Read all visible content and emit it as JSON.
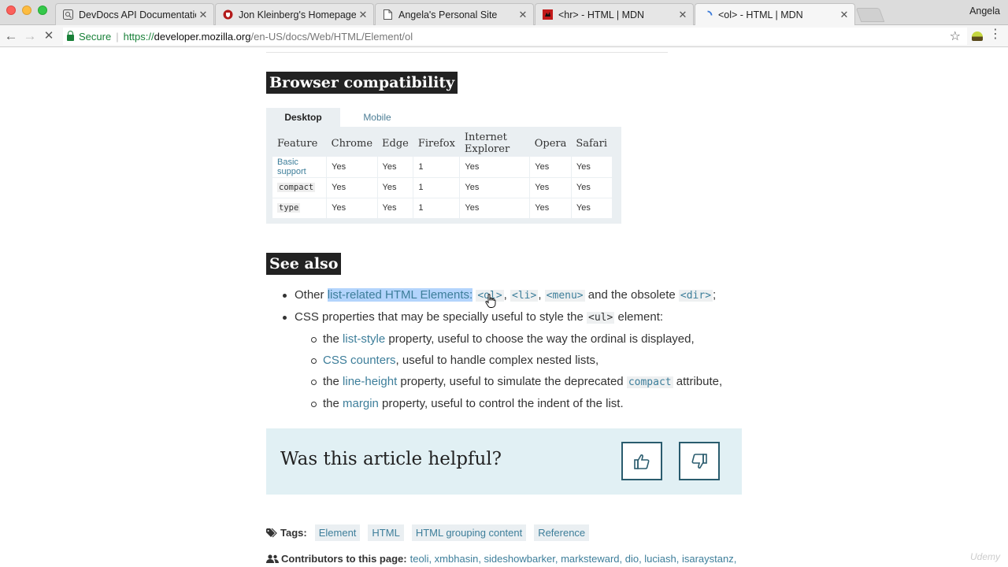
{
  "browser": {
    "tabs": [
      {
        "title": "DevDocs API Documentation",
        "icon": "devdocs-icon",
        "active": false
      },
      {
        "title": "Jon Kleinberg's Homepage",
        "icon": "shield-icon",
        "active": false
      },
      {
        "title": "Angela's Personal Site",
        "icon": "page-icon",
        "active": false
      },
      {
        "title": "<hr> - HTML | MDN",
        "icon": "mdn-icon",
        "active": false
      },
      {
        "title": "<ol> - HTML | MDN",
        "icon": "loading-spinner-icon",
        "active": true
      }
    ],
    "profile": "Angela",
    "secure_label": "Secure",
    "url_scheme": "https://",
    "url_host": "developer.mozilla.org",
    "url_path": "/en-US/docs/Web/HTML/Element/ol"
  },
  "compat": {
    "heading": "Browser compatibility",
    "tabs": [
      "Desktop",
      "Mobile"
    ],
    "headers": [
      "Feature",
      "Chrome",
      "Edge",
      "Firefox",
      "Internet Explorer",
      "Opera",
      "Safari"
    ],
    "rows": [
      {
        "feature": "Basic support",
        "is_code": false,
        "values": [
          "Yes",
          "Yes",
          "1",
          "Yes",
          "Yes",
          "Yes"
        ]
      },
      {
        "feature": "compact",
        "is_code": true,
        "values": [
          "Yes",
          "Yes",
          "1",
          "Yes",
          "Yes",
          "Yes"
        ]
      },
      {
        "feature": "type",
        "is_code": true,
        "values": [
          "Yes",
          "Yes",
          "1",
          "Yes",
          "Yes",
          "Yes"
        ]
      }
    ]
  },
  "see_also": {
    "heading": "See also",
    "item1": {
      "prefix": "Other ",
      "link": "list-related HTML Elements:",
      "ol": "<ol>",
      "li": "<li>",
      "menu": "<menu>",
      "middle": " and the obsolete ",
      "dir": "<dir>",
      "end": ";"
    },
    "item2": {
      "prefix": "CSS properties that may be specially useful to style the ",
      "code": "<ul>",
      "suffix": " element:"
    },
    "sub": [
      {
        "pre": "the ",
        "link": "list-style",
        "post": " property, useful to choose the way the ordinal is displayed,"
      },
      {
        "pre": "",
        "link": "CSS counters",
        "post": ", useful to handle complex nested lists,"
      },
      {
        "pre": "the ",
        "link": "line-height",
        "post": " property, useful to simulate the deprecated ",
        "code": "compact",
        "post2": " attribute,"
      },
      {
        "pre": "the ",
        "link": "margin",
        "post": " property, useful to control the indent of the list."
      }
    ]
  },
  "feedback": {
    "question": "Was this article helpful?"
  },
  "tags": {
    "label": "Tags:",
    "items": [
      "Element",
      "HTML",
      "HTML grouping content",
      "Reference"
    ]
  },
  "contributors": {
    "label": "Contributors to this page:",
    "names": "teoli, xmbhasin, sideshowbarker, marksteward, dio, luciash, isaraystanz,"
  },
  "watermark": "Udemy"
}
